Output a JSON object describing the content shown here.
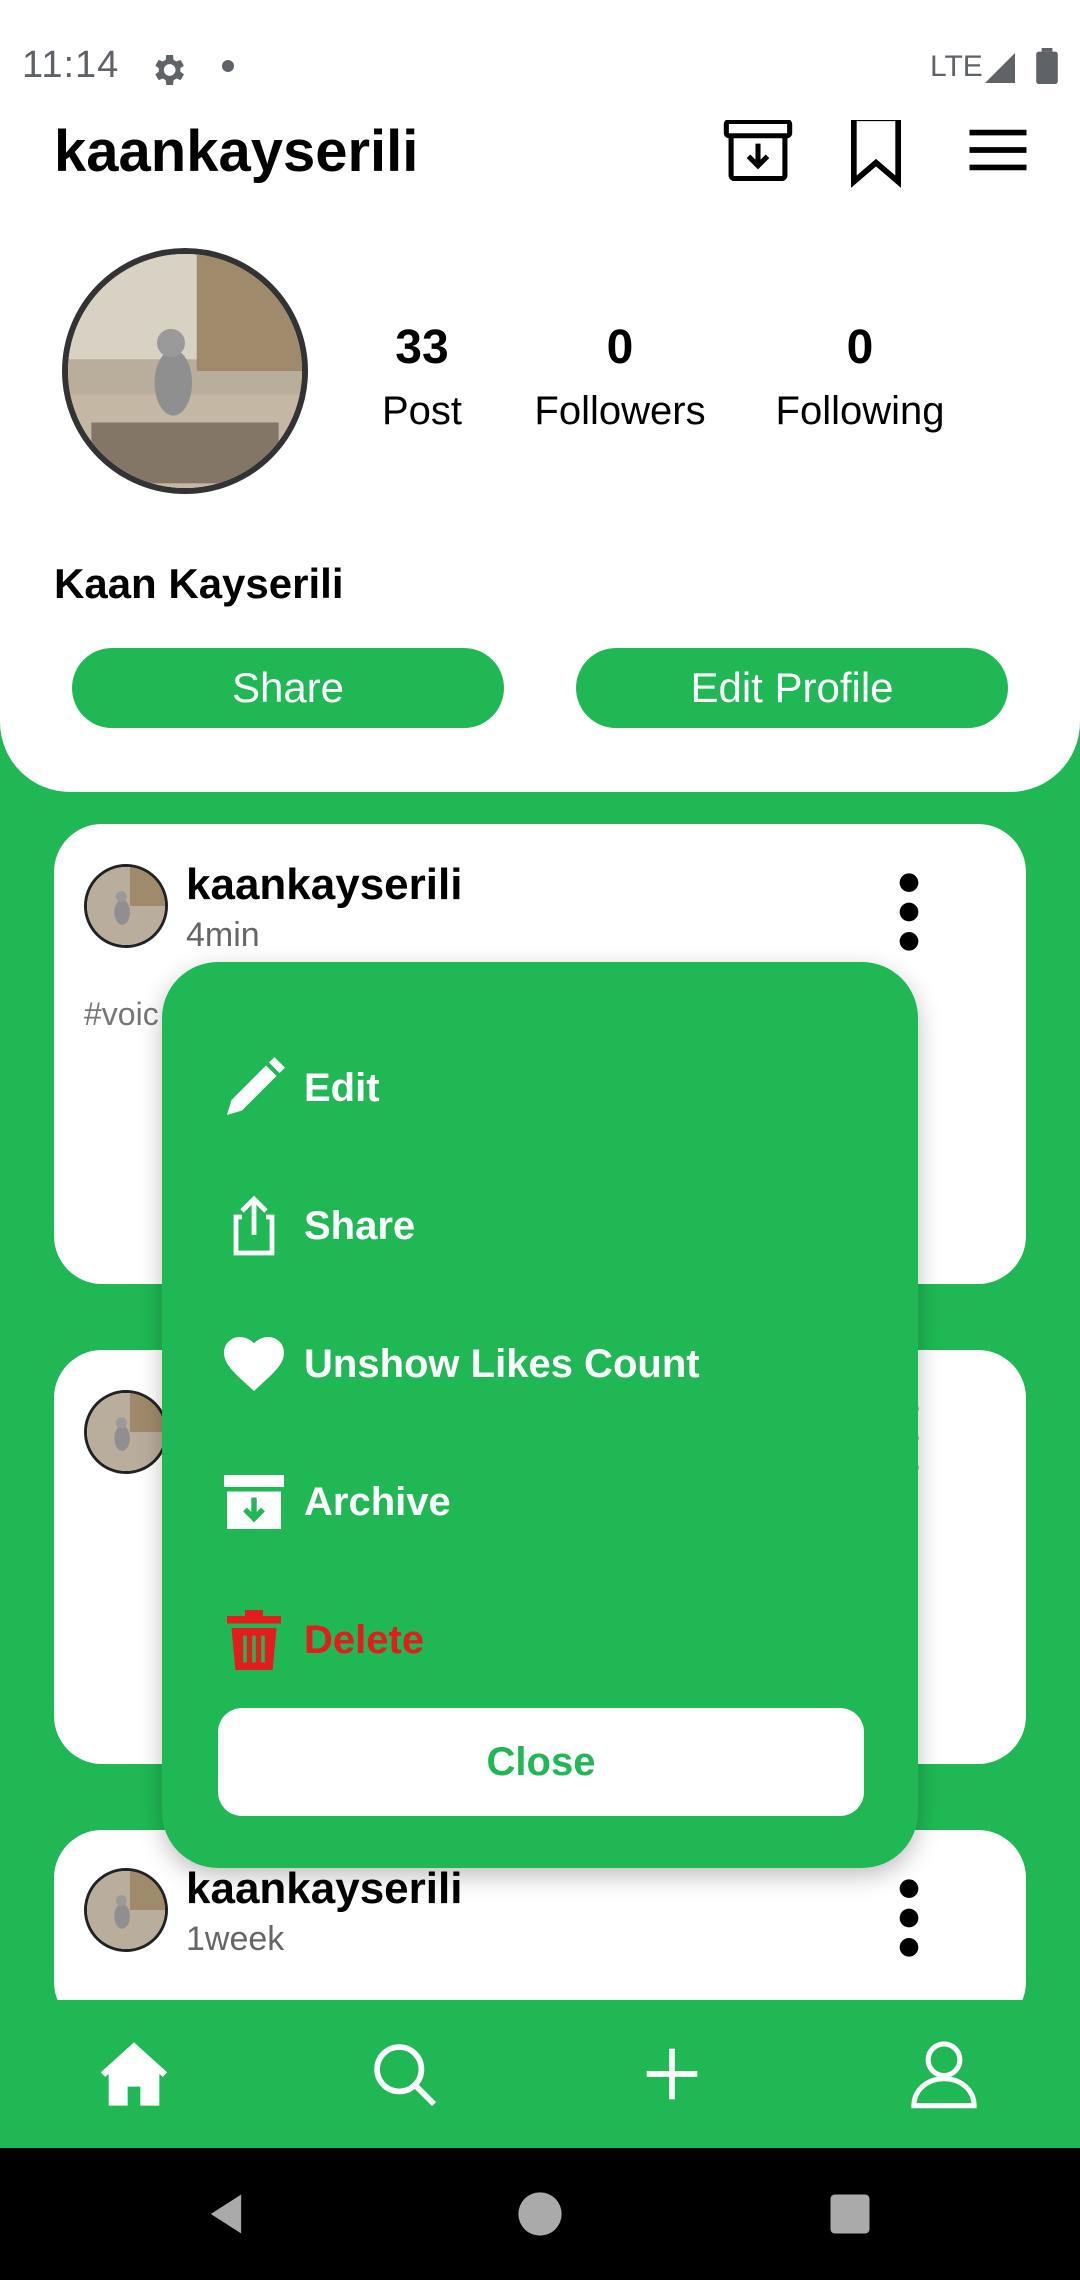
{
  "status_bar": {
    "time": "11:14",
    "network": "LTE"
  },
  "header": {
    "username": "kaankayserili"
  },
  "profile": {
    "stats": [
      {
        "count": "33",
        "label": "Post"
      },
      {
        "count": "0",
        "label": "Followers"
      },
      {
        "count": "0",
        "label": "Following"
      }
    ],
    "full_name": "Kaan Kayserili",
    "share_label": "Share",
    "edit_label": "Edit Profile"
  },
  "posts": [
    {
      "username": "kaankayserili",
      "time": "4min",
      "tag": "#voic"
    },
    {
      "username": "",
      "time": ""
    },
    {
      "username": "kaankayserili",
      "time": "1week"
    }
  ],
  "menu": {
    "items": [
      {
        "label": "Edit",
        "icon": "pencil-icon"
      },
      {
        "label": "Share",
        "icon": "share-icon"
      },
      {
        "label": "Unshow Likes Count",
        "icon": "heart-icon"
      },
      {
        "label": "Archive",
        "icon": "archive-icon"
      },
      {
        "label": "Delete",
        "icon": "trash-icon"
      }
    ],
    "close_label": "Close"
  },
  "colors": {
    "accent": "#1fb855",
    "danger": "#e31c1c"
  }
}
